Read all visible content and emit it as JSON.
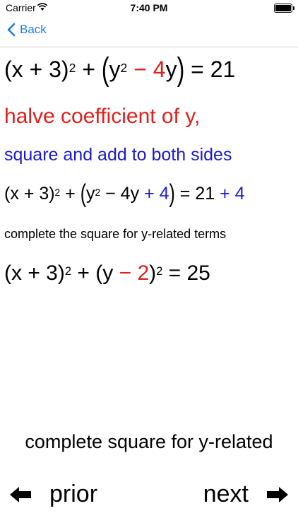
{
  "status_bar": {
    "carrier": "Carrier",
    "time": "7:40 PM"
  },
  "nav": {
    "back_label": "Back"
  },
  "steps": {
    "eq1": {
      "a": "(x + 3)",
      "a_exp": "2",
      "plus": " + ",
      "lp": "(",
      "b": "y",
      "b_exp": "2",
      "red_term": " − 4",
      "c": "y",
      "rp": ")",
      "rhs": " = 21"
    },
    "instruction_red": "halve coefficient of y,",
    "instruction_blue": "square and add to both sides",
    "eq2": {
      "a": "(x + 3)",
      "a_exp": "2",
      "plus": " + ",
      "lp": "(",
      "b": "y",
      "b_exp": "2",
      "mid": " − 4y",
      "blue_add": " + 4",
      "rp": ")",
      "rhs": " = 21",
      "rhs_blue": " + 4"
    },
    "note": "complete the square for y-related terms",
    "eq3": {
      "a": "(x + 3)",
      "a_exp": "2",
      "plus": " + ",
      "lp": "(y",
      "red_term": " − 2",
      "rp": ")",
      "rp_exp": "2",
      "rhs": " = 25"
    }
  },
  "footer": {
    "title": "complete square for y-related",
    "prior_label": "prior",
    "next_label": "next"
  },
  "icons": {
    "back": "chevron-left-icon",
    "prior": "arrow-left-icon",
    "next": "arrow-right-icon",
    "wifi": "wifi-icon",
    "battery": "battery-icon"
  },
  "colors": {
    "accent": "#1c7cf4",
    "red": "#e0201c",
    "blue": "#1a1ad0"
  }
}
